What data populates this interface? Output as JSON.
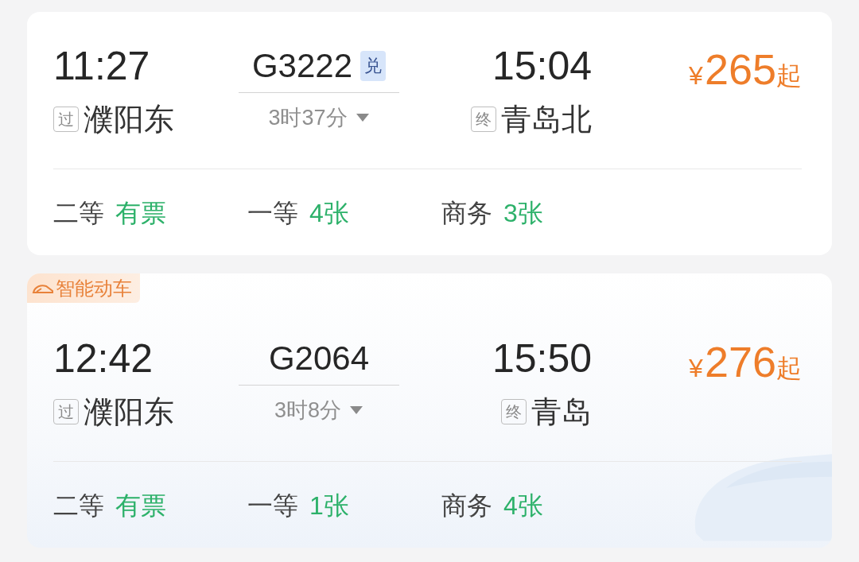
{
  "trains": [
    {
      "depart_time": "11:27",
      "depart_tag": "过",
      "depart_station": "濮阳东",
      "train_no": "G3222",
      "exchange_tag": "兑",
      "duration": "3时37分",
      "arrive_time": "15:04",
      "arrive_tag": "终",
      "arrive_station": "青岛北",
      "price_symbol": "¥",
      "price": "265",
      "price_suffix": "起",
      "seats": [
        {
          "class": "二等",
          "availability": "有票"
        },
        {
          "class": "一等",
          "availability": "4张"
        },
        {
          "class": "商务",
          "availability": "3张"
        }
      ]
    },
    {
      "badge": "智能动车",
      "depart_time": "12:42",
      "depart_tag": "过",
      "depart_station": "濮阳东",
      "train_no": "G2064",
      "duration": "3时8分",
      "arrive_time": "15:50",
      "arrive_tag": "终",
      "arrive_station": "青岛",
      "price_symbol": "¥",
      "price": "276",
      "price_suffix": "起",
      "seats": [
        {
          "class": "二等",
          "availability": "有票"
        },
        {
          "class": "一等",
          "availability": "1张"
        },
        {
          "class": "商务",
          "availability": "4张"
        }
      ]
    }
  ]
}
